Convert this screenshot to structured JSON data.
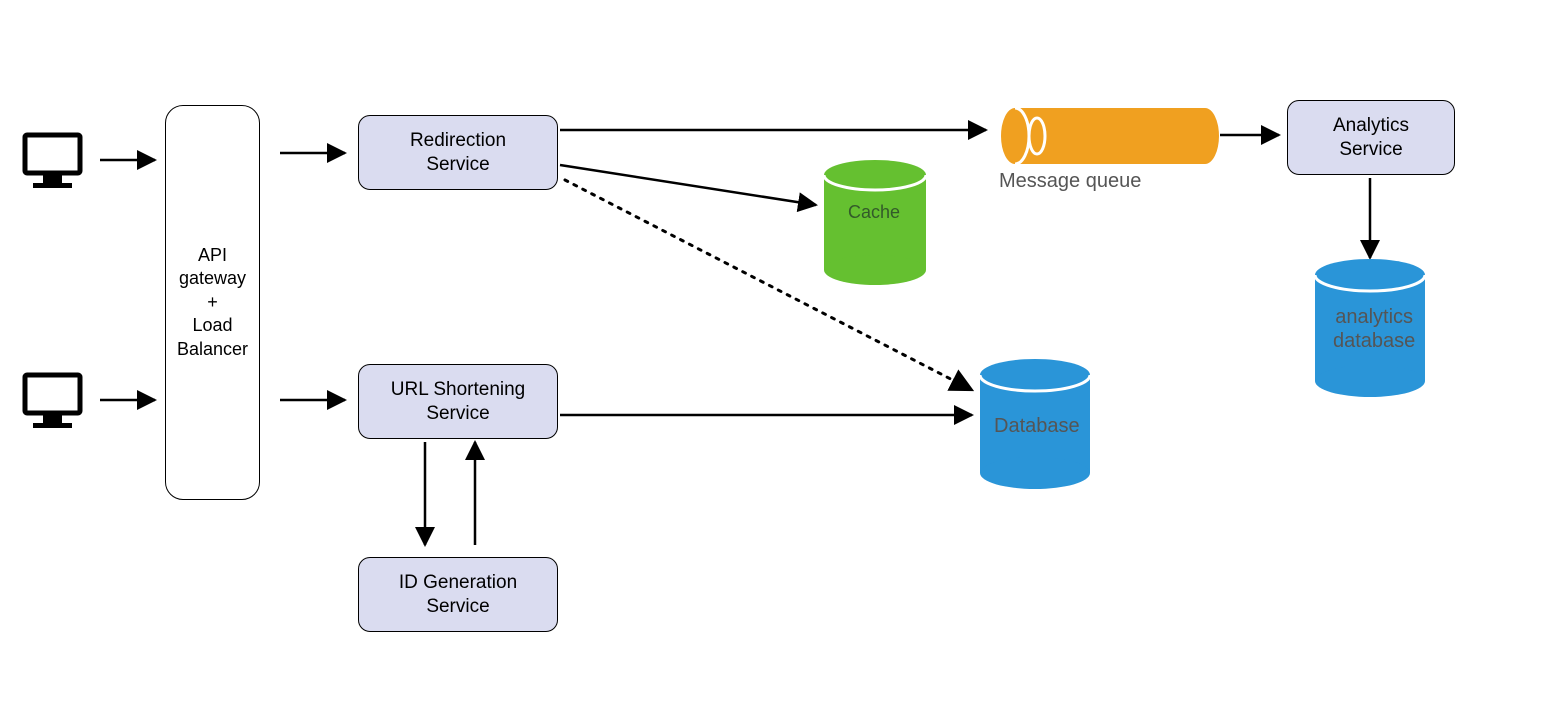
{
  "nodes": {
    "gateway": "API\ngateway\n+\nLoad\nBalancer",
    "redirection": "Redirection\nService",
    "url_shortening": "URL Shortening\nService",
    "id_generation": "ID Generation\nService",
    "analytics": "Analytics\nService",
    "cache": "Cache",
    "database": "Database",
    "analytics_db": "analytics\ndatabase",
    "message_queue": "Message queue"
  },
  "colors": {
    "service_fill": "#dadcf0",
    "cache_fill": "#65c030",
    "db_fill": "#2a95d8",
    "queue_fill": "#f0a020"
  }
}
